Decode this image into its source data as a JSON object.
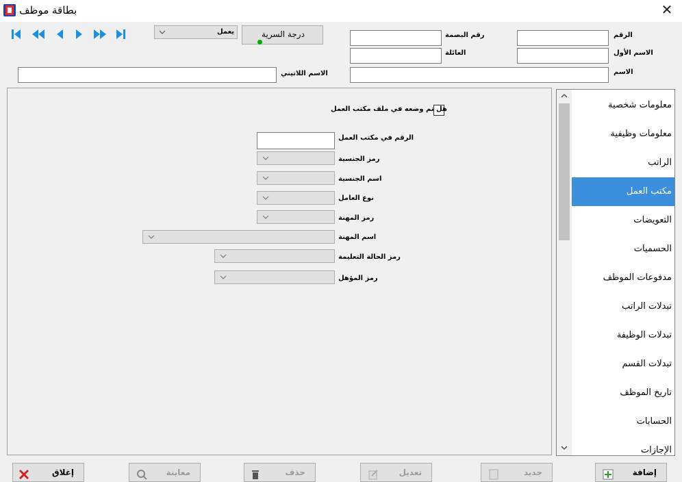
{
  "window": {
    "title": "بطاقة موظف"
  },
  "header": {
    "number_label": "الرقم",
    "fingerprint_label": "رقم البصمة",
    "first_name_label": "الاسم الأول",
    "family_label": "العائلة",
    "name_label": "الاسم",
    "latin_name_label": "الاسم اللاتيني",
    "secrecy_button": "درجة السرية",
    "status_value": "يعمل"
  },
  "form": {
    "labor_office_question": "هل تم وضعه في ملف مكتب العمل",
    "labor_office_number_label": "الرقم في مكتب العمل",
    "nationality_code_label": "رمز الجنسية",
    "nationality_name_label": "اسم الجنسية",
    "worker_type_label": "نوع العامل",
    "profession_code_label": "رمز المهنة",
    "profession_name_label": "اسم المهنة",
    "education_code_label": "رمز الحالة التعليمة",
    "qualification_code_label": "رمز المؤهل"
  },
  "sidebar": {
    "items": [
      {
        "label": "معلومات شخصية"
      },
      {
        "label": "معلومات وظيفية"
      },
      {
        "label": "الراتب"
      },
      {
        "label": "مكتب العمل"
      },
      {
        "label": "التعويضات"
      },
      {
        "label": "الحسميات"
      },
      {
        "label": "مدفوعات الموظف"
      },
      {
        "label": "تبدلات الراتب"
      },
      {
        "label": "تبدلات الوظيفة"
      },
      {
        "label": "تبدلات القسم"
      },
      {
        "label": "تاريخ الموظف"
      },
      {
        "label": "الحسابات"
      },
      {
        "label": "الإجازات"
      }
    ],
    "active_index": 3
  },
  "toolbar": {
    "add_label": "إضافة",
    "new_label": "جديد",
    "edit_label": "تعديل",
    "delete_label": "حذف",
    "preview_label": "معاينة",
    "close_label": "إغلاق"
  },
  "colors": {
    "accent": "#3c8fdc",
    "nav_blue": "#1e90e0",
    "status_green": "#00b000"
  }
}
